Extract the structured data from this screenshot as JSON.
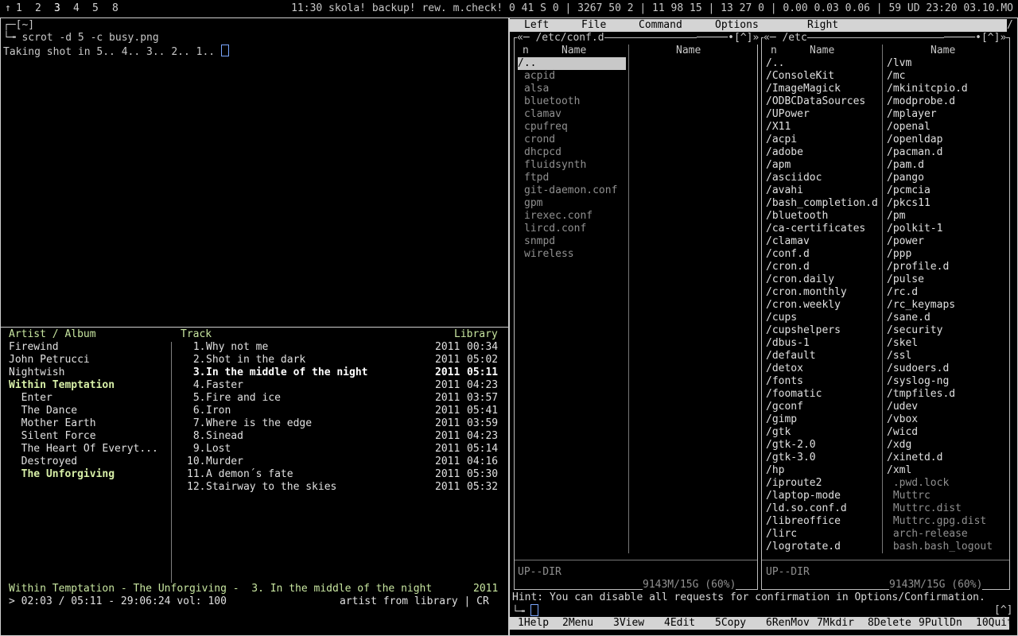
{
  "topbar": {
    "workspaces": [
      "1",
      "2",
      "3",
      "4",
      "5",
      "8"
    ],
    "active_workspace": "3",
    "status": "11:30 skola! backup! rew. m.check! 0 41 S 0 | 3267 50 2 | 11 98 15 | 13 27 0 | 0.00 0.03 0.06 | 59 UD 23:20 03.10.MO"
  },
  "terminal": {
    "title": "[~]",
    "command": "scrot -d 5 -c busy.png",
    "output": "Taking shot in 5.. 4.. 3.. 2.. 1.."
  },
  "cmus": {
    "header_artist": "Artist / Album",
    "header_track": "Track",
    "header_library": "Library",
    "artists": [
      {
        "name": "Firewind",
        "style": "normal"
      },
      {
        "name": "John Petrucci",
        "style": "normal"
      },
      {
        "name": "Nightwish",
        "style": "normal"
      },
      {
        "name": "Within Temptation",
        "style": "active-artist"
      },
      {
        "name": "  Enter",
        "style": "normal"
      },
      {
        "name": "  The Dance",
        "style": "normal"
      },
      {
        "name": "  Mother Earth",
        "style": "normal"
      },
      {
        "name": "  Silent Force",
        "style": "normal"
      },
      {
        "name": "  The Heart Of Everyt...",
        "style": "normal"
      },
      {
        "name": "  Destroyed",
        "style": "normal"
      },
      {
        "name": "  The Unforgiving",
        "style": "active-album"
      }
    ],
    "tracks": [
      {
        "num": " 1.",
        "title": "Why not me",
        "year": "2011",
        "dur": "00:34",
        "playing": false
      },
      {
        "num": " 2.",
        "title": "Shot in the dark",
        "year": "2011",
        "dur": "05:02",
        "playing": false
      },
      {
        "num": " 3.",
        "title": "In the middle of the night",
        "year": "2011",
        "dur": "05:11",
        "playing": true
      },
      {
        "num": " 4.",
        "title": "Faster",
        "year": "2011",
        "dur": "04:23",
        "playing": false
      },
      {
        "num": " 5.",
        "title": "Fire and ice",
        "year": "2011",
        "dur": "03:57",
        "playing": false
      },
      {
        "num": " 6.",
        "title": "Iron",
        "year": "2011",
        "dur": "05:41",
        "playing": false
      },
      {
        "num": " 7.",
        "title": "Where is the edge",
        "year": "2011",
        "dur": "03:59",
        "playing": false
      },
      {
        "num": " 8.",
        "title": "Sinead",
        "year": "2011",
        "dur": "04:23",
        "playing": false
      },
      {
        "num": " 9.",
        "title": "Lost",
        "year": "2011",
        "dur": "05:14",
        "playing": false
      },
      {
        "num": "10.",
        "title": "Murder",
        "year": "2011",
        "dur": "04:16",
        "playing": false
      },
      {
        "num": "11.",
        "title": "A demon´s fate",
        "year": "2011",
        "dur": "05:30",
        "playing": false
      },
      {
        "num": "12.",
        "title": "Stairway to the skies",
        "year": "2011",
        "dur": "05:32",
        "playing": false
      }
    ],
    "now_playing": "Within Temptation - The Unforgiving -  3. In the middle of the night",
    "now_playing_year": "2011",
    "position": "> 02:03 / 05:11 - 29:06:24 vol: 100",
    "mode": "artist from library | CR"
  },
  "mc": {
    "menu": [
      "Left",
      "File",
      "Command",
      "Options",
      "Right"
    ],
    "left_panel": {
      "path": "/etc/conf.d",
      "corner": "[^]",
      "col_n": "n",
      "col_name1": "Name",
      "col_name2": "Name",
      "items": [
        "/..",
        "acpid",
        "alsa",
        "bluetooth",
        "clamav",
        "cpufreq",
        "crond",
        "dhcpcd",
        "fluidsynth",
        "ftpd",
        "git-daemon.conf",
        "gpm",
        "irexec.conf",
        "lircd.conf",
        "snmpd",
        "wireless"
      ],
      "status": "UP--DIR",
      "disk": "9143M/15G (60%)"
    },
    "right_panel": {
      "path": "/etc",
      "corner": "[^]",
      "col_n": "n",
      "col_name1": "Name",
      "col_name2": "Name",
      "col1": [
        "/..",
        "/ConsoleKit",
        "/ImageMagick",
        "/ODBCDataSources",
        "/UPower",
        "/X11",
        "/acpi",
        "/adobe",
        "/apm",
        "/asciidoc",
        "/avahi",
        "/bash_completion.d",
        "/bluetooth",
        "/ca-certificates",
        "/clamav",
        "/conf.d",
        "/cron.d",
        "/cron.daily",
        "/cron.monthly",
        "/cron.weekly",
        "/cups",
        "/cupshelpers",
        "/dbus-1",
        "/default",
        "/detox",
        "/fonts",
        "/foomatic",
        "/gconf",
        "/gimp",
        "/gtk",
        "/gtk-2.0",
        "/gtk-3.0",
        "/hp",
        "/iproute2",
        "/laptop-mode",
        "/ld.so.conf.d",
        "/libreoffice",
        "/lirc",
        "/logrotate.d"
      ],
      "col2": [
        "/lvm",
        "/mc",
        "/mkinitcpio.d",
        "/modprobe.d",
        "/mplayer",
        "/openal",
        "/openldap",
        "/pacman.d",
        "/pam.d",
        "/pango",
        "/pcmcia",
        "/pkcs11",
        "/pm",
        "/polkit-1",
        "/power",
        "/ppp",
        "/profile.d",
        "/pulse",
        "/rc.d",
        "/rc_keymaps",
        "/sane.d",
        "/security",
        "/skel",
        "/ssl",
        "/sudoers.d",
        "/syslog-ng",
        "/tmpfiles.d",
        "/udev",
        "/vbox",
        "/wicd",
        "/xdg",
        "/xinetd.d",
        "/xml"
      ],
      "col2_files": [
        " .pwd.lock",
        " Muttrc",
        " Muttrc.dist",
        " Muttrc.gpg.dist",
        " arch-release",
        " bash.bash_logout"
      ],
      "status": "UP--DIR",
      "disk": "9143M/15G (60%)"
    },
    "hint": "Hint: You can disable all requests for confirmation in Options/Confirmation.",
    "fkeys": [
      {
        "num": "1",
        "label": "Help"
      },
      {
        "num": "2",
        "label": "Menu"
      },
      {
        "num": "3",
        "label": "View"
      },
      {
        "num": "4",
        "label": "Edit"
      },
      {
        "num": "5",
        "label": "Copy"
      },
      {
        "num": "6",
        "label": "RenMov"
      },
      {
        "num": "7",
        "label": "Mkdir"
      },
      {
        "num": "8",
        "label": "Delete"
      },
      {
        "num": "9",
        "label": "PullDn"
      },
      {
        "num": "10",
        "label": "Quit"
      }
    ]
  }
}
